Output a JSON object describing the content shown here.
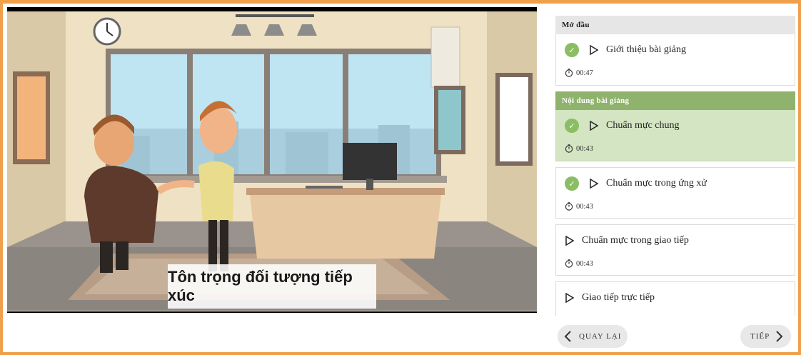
{
  "video": {
    "caption": "Tôn trọng đối tượng tiếp xúc"
  },
  "playlist": {
    "sections": [
      {
        "title": "Mở đầu"
      },
      {
        "title": "Nội dung bài giảng"
      }
    ],
    "items": [
      {
        "title": "Giới thiệu bài giảng",
        "duration": "00:47",
        "completed": true,
        "active": false
      },
      {
        "title": "Chuẩn mực chung",
        "duration": "00:43",
        "completed": true,
        "active": true
      },
      {
        "title": "Chuẩn mực trong ứng xử",
        "duration": "00:43",
        "completed": true,
        "active": false
      },
      {
        "title": "Chuẩn mực trong giao tiếp",
        "duration": "00:43",
        "completed": false,
        "active": false
      },
      {
        "title": "Giao tiếp trực tiếp",
        "duration": "",
        "completed": false,
        "active": false
      }
    ]
  },
  "nav": {
    "back_label": "QUAY LẠI",
    "next_label": "TIẾP"
  },
  "icons": {
    "check": "check-icon",
    "play": "play-icon",
    "clock": "clock-icon",
    "back": "chevron-left-icon",
    "next": "chevron-right-icon"
  },
  "colors": {
    "frame": "#f0a04b",
    "active_section": "#8fb36d",
    "active_item": "#d3e5c2",
    "check": "#8bbd64"
  }
}
